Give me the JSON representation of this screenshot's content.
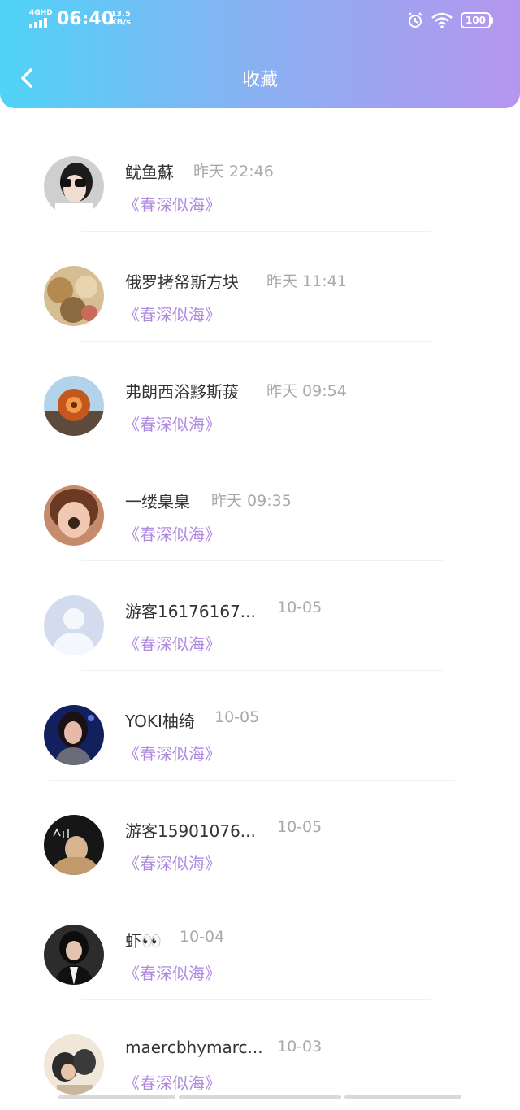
{
  "status_bar": {
    "network": "4GHD",
    "time": "06:40",
    "speed_value": "13.5",
    "speed_unit": "KB/s",
    "battery": "100"
  },
  "header": {
    "title": "收藏"
  },
  "items": [
    {
      "name": "鱿鱼蘇",
      "time": "昨天 22:46",
      "work": "《春深似海》"
    },
    {
      "name": "俄罗拷帑斯方块",
      "time": "昨天 11:41",
      "work": "《春深似海》"
    },
    {
      "name": "弗朗西浴黟斯菝",
      "time": "昨天 09:54",
      "work": "《春深似海》"
    },
    {
      "name": "一缕臬臬",
      "time": "昨天 09:35",
      "work": "《春深似海》"
    },
    {
      "name": "游客16176167...",
      "time": "10-05",
      "work": "《春深似海》"
    },
    {
      "name": "YOKI柚绮",
      "time": "10-05",
      "work": "《春深似海》"
    },
    {
      "name": "游客15901076...",
      "time": "10-05",
      "work": "《春深似海》"
    },
    {
      "name": "虾👀",
      "time": "10-04",
      "work": "《春深似海》"
    },
    {
      "name": "maercbhymarc...",
      "time": "10-03",
      "work": "《春深似海》"
    }
  ]
}
